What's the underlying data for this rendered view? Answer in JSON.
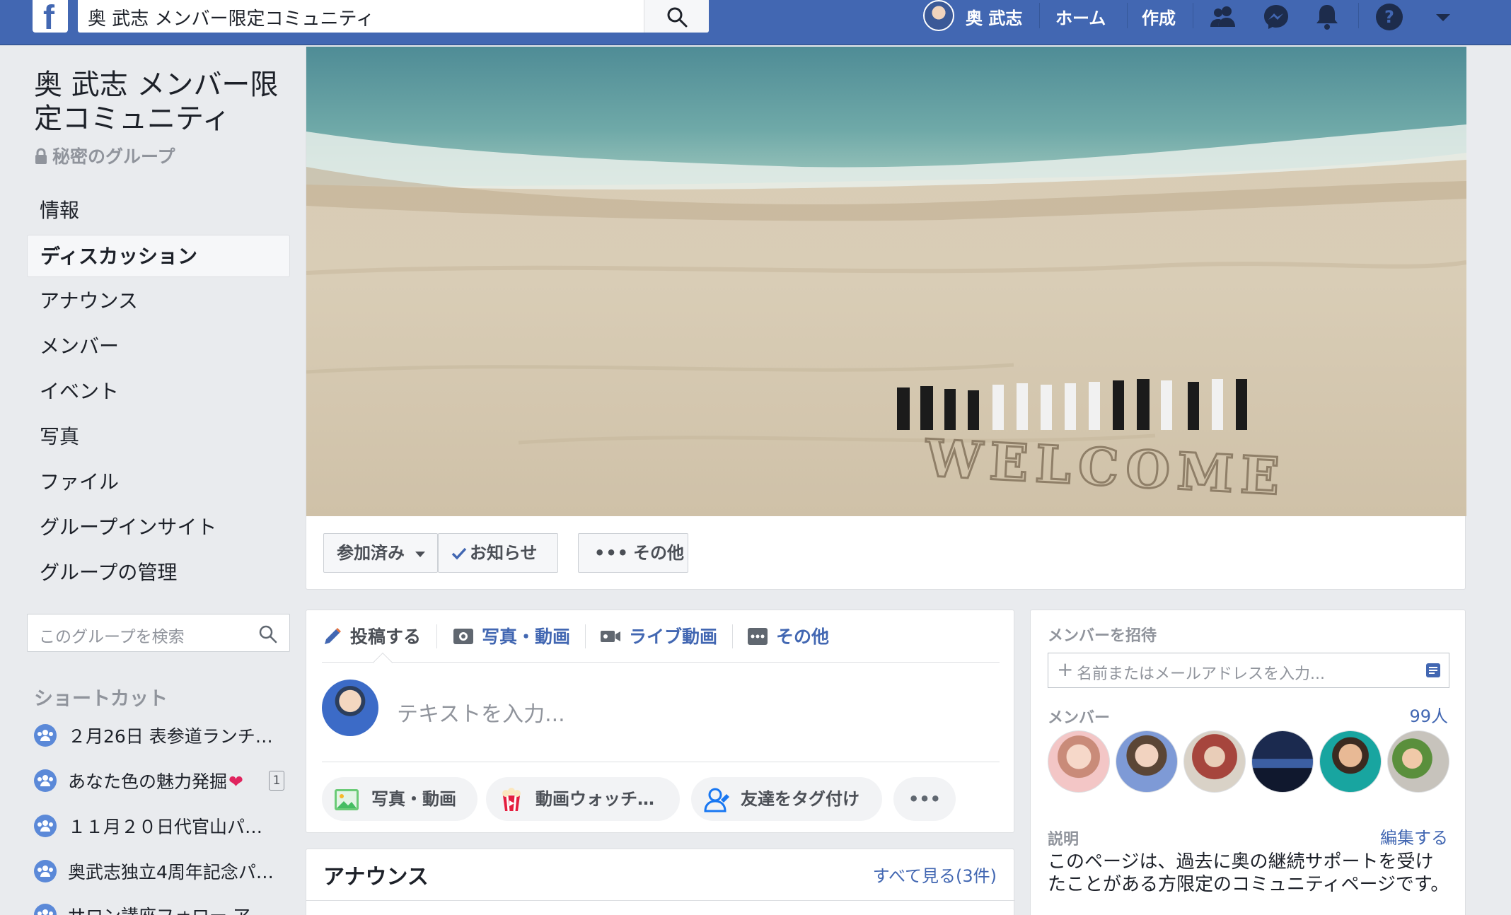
{
  "topbar": {
    "logo": "f",
    "search_value": "奥 武志 メンバー限定コミュニティ",
    "user_name": "奥 武志",
    "home": "ホーム",
    "create": "作成",
    "icons": [
      "friends-icon",
      "messenger-icon",
      "bell-icon",
      "help-icon",
      "dropdown-icon"
    ]
  },
  "group": {
    "title": "奥 武志 メンバー限定コミュニティ",
    "privacy": "秘密のグループ"
  },
  "sidebar": {
    "items": [
      {
        "label": "情報"
      },
      {
        "label": "ディスカッション",
        "active": true
      },
      {
        "label": "アナウンス"
      },
      {
        "label": "メンバー"
      },
      {
        "label": "イベント"
      },
      {
        "label": "写真"
      },
      {
        "label": "ファイル"
      },
      {
        "label": "グループインサイト"
      },
      {
        "label": "グループの管理"
      }
    ],
    "search_placeholder": "このグループを検索",
    "shortcuts_title": "ショートカット",
    "shortcuts": [
      {
        "label": "２月26日 表参道ランチ…"
      },
      {
        "label": "あなた色の魅力発掘",
        "badge": "1"
      },
      {
        "label": "１１月２０日代官山パ…"
      },
      {
        "label": "奥武志独立4周年記念パ…"
      },
      {
        "label": "サロン講座フォロー ア…"
      }
    ]
  },
  "cover": {
    "sand_text": "WELCOME"
  },
  "actions": {
    "joined": "参加済み",
    "notifications": "お知らせ",
    "more": "その他"
  },
  "composer": {
    "tabs": [
      "投稿する",
      "写真・動画",
      "ライブ動画",
      "その他"
    ],
    "placeholder": "テキストを入力...",
    "pills": [
      "写真・動画",
      "動画ウォッチ…",
      "友達をタグ付け",
      "•••"
    ]
  },
  "announce": {
    "title": "アナウンス",
    "see_all": "すべて見る(3件)"
  },
  "right": {
    "invite_label": "メンバーを招待",
    "invite_placeholder": "名前またはメールアドレスを入力...",
    "members_label": "メンバー",
    "member_count": "99人",
    "description_label": "説明",
    "edit": "編集する",
    "description": "このページは、過去に奥の継続サポートを受けたことがある方限定のコミュニティページです。"
  },
  "colors": {
    "brand": "#4267b2",
    "background": "#e9ebee",
    "link": "#4267b2",
    "muted": "#90949c"
  }
}
